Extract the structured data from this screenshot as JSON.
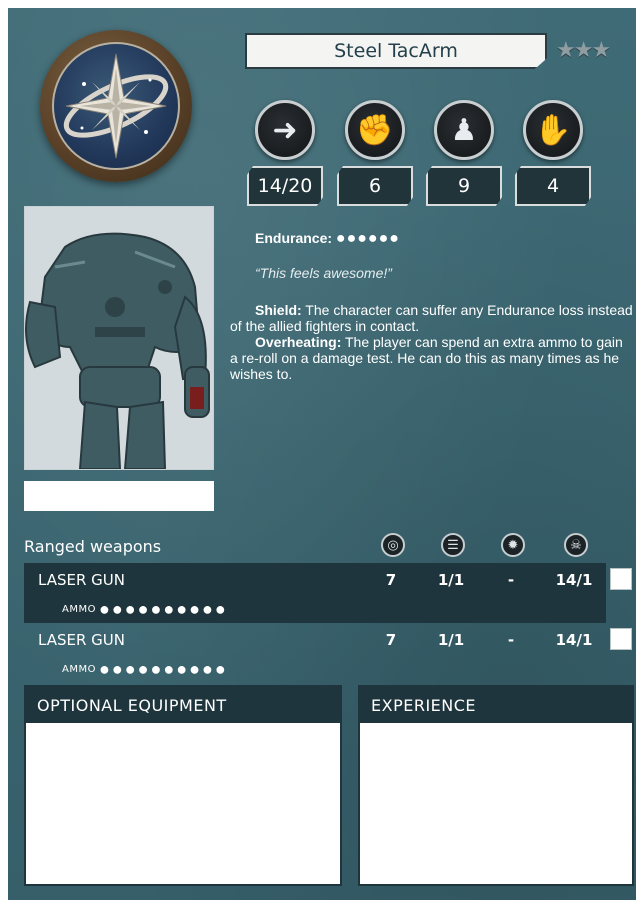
{
  "card": {
    "name": "Steel TacArm",
    "rank_stars": "★★★",
    "stats": [
      {
        "icon": "movement-arrow-icon",
        "glyph": "➜",
        "value": "14/20"
      },
      {
        "icon": "melee-fist-icon",
        "glyph": "✊",
        "value": "6"
      },
      {
        "icon": "defense-armor-icon",
        "glyph": "♟",
        "value": "9"
      },
      {
        "icon": "attack-claw-icon",
        "glyph": "✋",
        "value": "4"
      }
    ],
    "endurance_label": "Endurance:",
    "endurance_dots": "●●●●●●",
    "quote": "“This feels awesome!”",
    "abilities": [
      {
        "name": "Shield:",
        "text": " The character can suffer any Endurance loss instead of the allied fighters in contact."
      },
      {
        "name": "Overheating:",
        "text": " The player can spend an extra ammo to gain a re-roll on a damage test. He can do this as many times as he wishes to."
      }
    ]
  },
  "weapons": {
    "section_label": "Ranged weapons",
    "columns": [
      {
        "icon": "target-icon",
        "glyph": "◎"
      },
      {
        "icon": "burst-icon",
        "glyph": "☰"
      },
      {
        "icon": "gear-blast-icon",
        "glyph": "✹"
      },
      {
        "icon": "skull-icon",
        "glyph": "☠"
      }
    ],
    "rows": [
      {
        "name": "LASER GUN",
        "c1": "7",
        "c2": "1/1",
        "c3": "-",
        "c4": "14/1",
        "ammo_label": "AMMO",
        "ammo": "●●●●●●●●●●"
      },
      {
        "name": "LASER GUN",
        "c1": "7",
        "c2": "1/1",
        "c3": "-",
        "c4": "14/1",
        "ammo_label": "AMMO",
        "ammo": "●●●●●●●●●●"
      }
    ]
  },
  "panels": {
    "optional_equipment": "OPTIONAL EQUIPMENT",
    "experience": "EXPERIENCE"
  },
  "colors": {
    "card_bg": "#3a6570",
    "dark_band": "#1f353d",
    "emblem_bronze": "#5a4128",
    "emblem_blue": "#22385a"
  }
}
